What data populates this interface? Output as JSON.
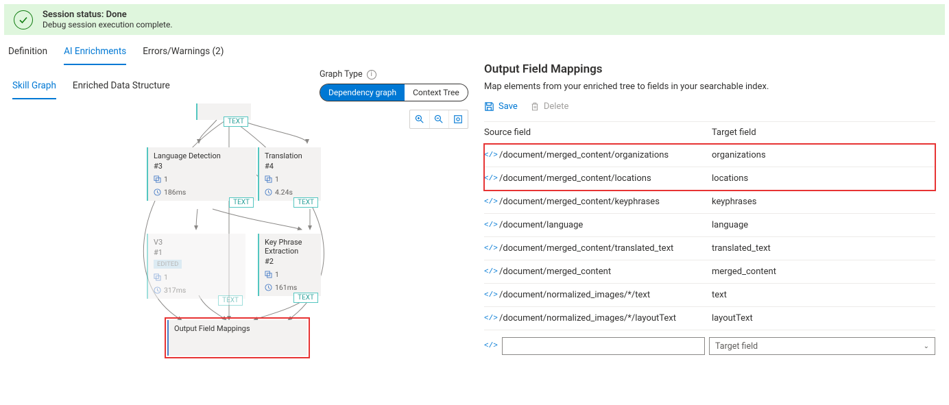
{
  "status": {
    "title": "Session status: Done",
    "subtitle": "Debug session execution complete."
  },
  "top_tabs": {
    "definition": "Definition",
    "ai_enrichments": "AI Enrichments",
    "errors_warnings": "Errors/Warnings (2)"
  },
  "sub_tabs": {
    "skill_graph": "Skill Graph",
    "enriched_data": "Enriched Data Structure"
  },
  "graph_type": {
    "label": "Graph Type",
    "dependency": "Dependency graph",
    "context": "Context Tree"
  },
  "nodes": {
    "lang": {
      "name": "Language Detection",
      "id": "#3",
      "count": "1",
      "time": "186ms",
      "tag": "TEXT"
    },
    "trans": {
      "name": "Translation",
      "id": "#4",
      "count": "1",
      "time": "4.24s",
      "tag": "TEXT"
    },
    "v3": {
      "name": "V3",
      "id": "#1",
      "badge": "EDITED",
      "count": "1",
      "time": "317ms",
      "tag": "TEXT"
    },
    "key": {
      "name": "Key Phrase Extraction",
      "id": "#2",
      "count": "1",
      "time": "161ms",
      "tag": "TEXT"
    },
    "out": {
      "name": "Output Field Mappings"
    },
    "top_tag": "TEXT"
  },
  "right": {
    "title": "Output Field Mappings",
    "desc": "Map elements from your enriched tree to fields in your searchable index.",
    "save": "Save",
    "delete": "Delete",
    "head_source": "Source field",
    "head_target": "Target field",
    "rows": [
      {
        "source": "/document/merged_content/organizations",
        "target": "organizations"
      },
      {
        "source": "/document/merged_content/locations",
        "target": "locations"
      },
      {
        "source": "/document/merged_content/keyphrases",
        "target": "keyphrases"
      },
      {
        "source": "/document/language",
        "target": "language"
      },
      {
        "source": "/document/merged_content/translated_text",
        "target": "translated_text"
      },
      {
        "source": "/document/merged_content",
        "target": "merged_content"
      },
      {
        "source": "/document/normalized_images/*/text",
        "target": "text"
      },
      {
        "source": "/document/normalized_images/*/layoutText",
        "target": "layoutText"
      }
    ],
    "target_placeholder": "Target field"
  }
}
